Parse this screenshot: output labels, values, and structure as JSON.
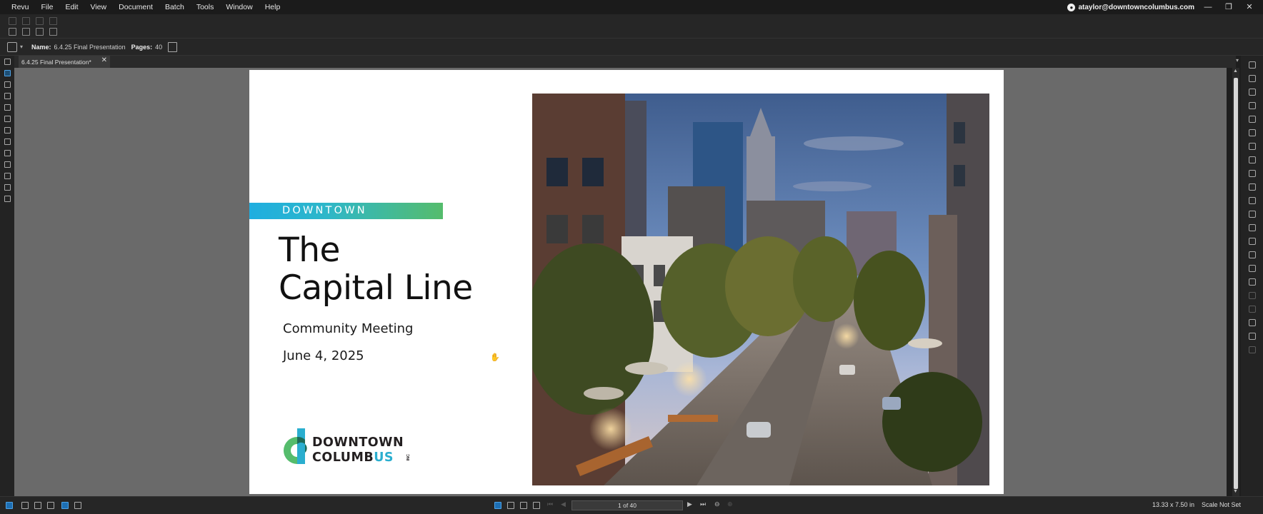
{
  "menubar": {
    "items": [
      "Revu",
      "File",
      "Edit",
      "View",
      "Document",
      "Batch",
      "Tools",
      "Window",
      "Help"
    ],
    "account": "ataylor@downtowncolumbus.com"
  },
  "propbar": {
    "name_label": "Name:",
    "name_value": "6.4.25 Final Presentation",
    "pages_label": "Pages:",
    "pages_value": "40"
  },
  "tab": {
    "label": "6.4.25 Final Presentation*"
  },
  "slide": {
    "banner": "DOWNTOWN COLUMBUS",
    "title_line1": "The",
    "title_line2": "Capital Line",
    "subtitle": "Community Meeting",
    "date": "June 4, 2025",
    "logo_line1": "DOWNTOWN",
    "logo_line2_a": "COLUMB",
    "logo_line2_b": "US",
    "logo_inc": "INC",
    "logo_colors": {
      "dark": "#231f20",
      "blue": "#2aaecf",
      "green": "#55bc6c"
    }
  },
  "status": {
    "page_field": "1 of 40",
    "page_size": "13.33 x 7.50 in",
    "scale": "Scale Not Set"
  },
  "colors": {
    "accent_blue": "#1d6fb4",
    "banner_start": "#1faee0",
    "banner_end": "#55bc6c"
  }
}
